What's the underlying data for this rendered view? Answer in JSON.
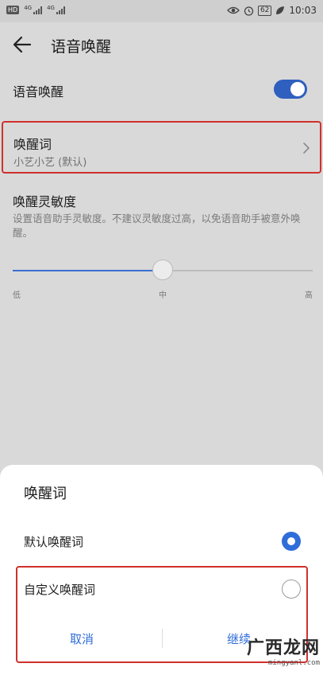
{
  "status_bar": {
    "hd_label": "HD",
    "net_label_1": "4G",
    "net_label_2": "4G",
    "battery_level": "62",
    "time": "10:03"
  },
  "app_bar": {
    "title": "语音唤醒"
  },
  "settings": {
    "voice_wakeup": {
      "label": "语音唤醒",
      "enabled": true
    },
    "wake_word": {
      "title": "唤醒词",
      "value": "小艺小艺 (默认)"
    },
    "sensitivity": {
      "title": "唤醒灵敏度",
      "description": "设置语音助手灵敏度。不建议灵敏度过高，以免语音助手被意外唤醒。",
      "value": 0.5,
      "label_low": "低",
      "label_mid": "中",
      "label_high": "高"
    }
  },
  "dialog": {
    "title": "唤醒词",
    "options": [
      {
        "label": "默认唤醒词",
        "selected": true
      },
      {
        "label": "自定义唤醒词",
        "selected": false
      }
    ],
    "cancel_label": "取消",
    "continue_label": "继续"
  },
  "watermark": {
    "logo_text": "广西龙网",
    "url": "mingyanl.com"
  },
  "colors": {
    "accent": "#2f6dd9",
    "highlight": "#d0302c",
    "toggle_on": "#2f5fbf"
  }
}
